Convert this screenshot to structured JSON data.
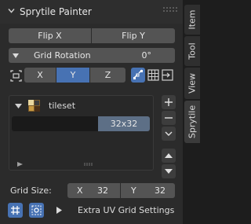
{
  "panel": {
    "title": "Sprytile Painter"
  },
  "flip": {
    "x_label": "Flip X",
    "y_label": "Flip Y"
  },
  "rotation": {
    "label": "Grid Rotation",
    "value": "0°"
  },
  "axis": {
    "options": [
      "X",
      "Y",
      "Z"
    ],
    "selected": "Y"
  },
  "tileset": {
    "name": "tileset",
    "size": "32x32"
  },
  "grid": {
    "label": "Grid Size:",
    "x_label": "X",
    "x_value": "32",
    "y_label": "Y",
    "y_value": "32"
  },
  "uv_settings": {
    "label": "Extra UV Grid Settings"
  },
  "tabs": {
    "items": [
      "Item",
      "Tool",
      "View",
      "Sprytile"
    ],
    "active": "Sprytile"
  },
  "colors": {
    "accent": "#4772b3",
    "panel": "#2b2b2b",
    "button": "#545454"
  }
}
